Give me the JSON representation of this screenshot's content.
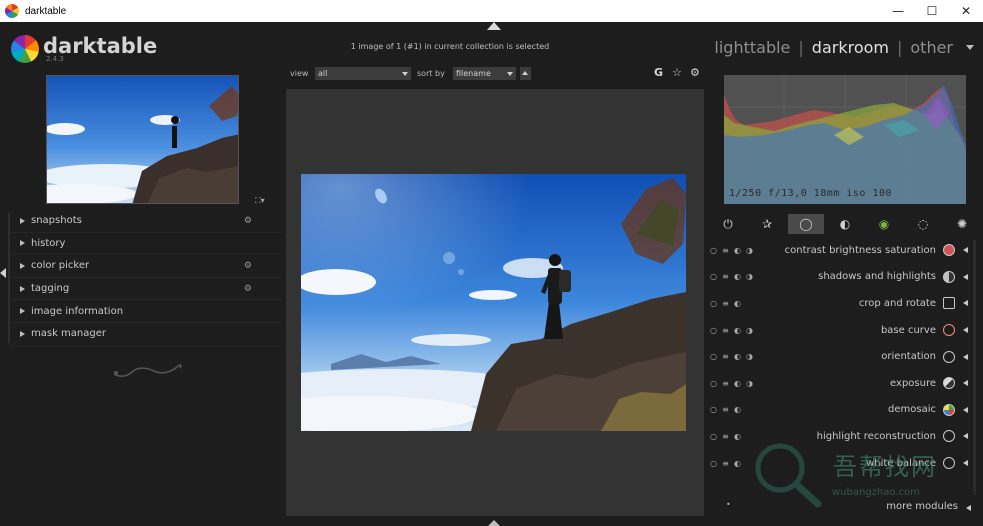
{
  "window": {
    "title": "darktable",
    "buttons": {
      "minimize": "—",
      "maximize": "☐",
      "close": "✕"
    }
  },
  "logo": {
    "name": "darktable",
    "version": "2.4.3"
  },
  "collection_status": "1 image of 1 (#1) in current collection is selected",
  "views": {
    "lighttable": "lighttable",
    "darkroom": "darkroom",
    "other": "other",
    "active": "darkroom",
    "separator": "|"
  },
  "toolbar": {
    "view_label": "view",
    "view_value": "all",
    "sort_label": "sort by",
    "sort_value": "filename",
    "icons": [
      "grouping-icon",
      "star-icon",
      "gear-icon"
    ],
    "grouping_glyph": "G",
    "star_glyph": "☆",
    "gear_glyph": "⚙"
  },
  "left_panel": {
    "modules": [
      {
        "label": "snapshots",
        "has_settings": true
      },
      {
        "label": "history",
        "has_settings": false
      },
      {
        "label": "color picker",
        "has_settings": true
      },
      {
        "label": "tagging",
        "has_settings": true
      },
      {
        "label": "image information",
        "has_settings": false
      },
      {
        "label": "mask manager",
        "has_settings": false
      }
    ],
    "settings_glyph": "⚙",
    "expand_glyph": "⛶▾"
  },
  "histogram": {
    "info": "1/250 f/13,0 18mm iso 100"
  },
  "module_groups": {
    "icons": [
      "power-icon",
      "star-icon",
      "basic-circle-icon",
      "tone-icon",
      "color-icon",
      "correct-icon",
      "effect-icon"
    ],
    "glyphs": [
      "⏻",
      "✰",
      "◯",
      "◐",
      "◉",
      "◌",
      "✺"
    ],
    "active": "basic-circle-icon"
  },
  "processing_modules": [
    {
      "name": "contrast brightness saturation",
      "ctrls": [
        "○",
        "≡",
        "◐",
        "◑"
      ],
      "icon_color": "#e57373"
    },
    {
      "name": "shadows and highlights",
      "ctrls": [
        "○",
        "≡",
        "◐",
        "◑"
      ],
      "icon_color": "#bdbdbd"
    },
    {
      "name": "crop and rotate",
      "ctrls": [
        "○",
        "≡",
        "◐"
      ],
      "icon_color": "#bdbdbd"
    },
    {
      "name": "base curve",
      "ctrls": [
        "○",
        "≡",
        "◐",
        "◑"
      ],
      "icon_color": "#ff8a65"
    },
    {
      "name": "orientation",
      "ctrls": [
        "○",
        "≡",
        "◐",
        "◑"
      ],
      "icon_color": "#bdbdbd"
    },
    {
      "name": "exposure",
      "ctrls": [
        "○",
        "≡",
        "◐",
        "◑"
      ],
      "icon_color": "#bdbdbd"
    },
    {
      "name": "demosaic",
      "ctrls": [
        "○",
        "≡",
        "◐"
      ],
      "icon_color": "#81c784"
    },
    {
      "name": "highlight reconstruction",
      "ctrls": [
        "○",
        "≡",
        "◐"
      ],
      "icon_color": "#bdbdbd"
    },
    {
      "name": "white balance",
      "ctrls": [
        "○",
        "≡",
        "◐"
      ],
      "icon_color": "#bdbdbd"
    }
  ],
  "more_modules": {
    "label": "more modules",
    "bullet": "•"
  },
  "watermark": {
    "text": "吾帮找网",
    "url": "wubangzhao.com"
  }
}
